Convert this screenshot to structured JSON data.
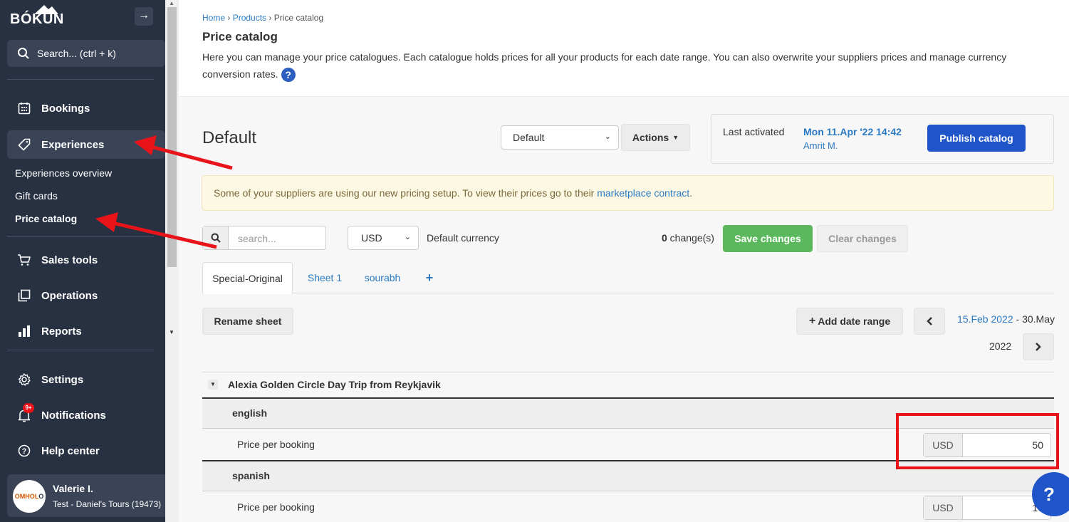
{
  "sidebar": {
    "logo": "BÓKUN",
    "search_label": "Search... (ctrl + k)",
    "nav": {
      "bookings": "Bookings",
      "experiences": "Experiences",
      "sales_tools": "Sales tools",
      "operations": "Operations",
      "reports": "Reports",
      "settings": "Settings",
      "notifications": "Notifications",
      "notifications_badge": "9+",
      "help_center": "Help center"
    },
    "sub_items": {
      "overview": "Experiences overview",
      "gift_cards": "Gift cards",
      "price_catalog": "Price catalog"
    },
    "user": {
      "avatar_text_a": "OMHOL",
      "avatar_text_b": "O",
      "name": "Valerie I.",
      "account": "Test - Daniel's Tours (19473)"
    }
  },
  "header": {
    "breadcrumb": [
      "Home",
      "Products",
      "Price catalog"
    ],
    "title": "Price catalog",
    "description": "Here you can manage your price catalogues. Each catalogue holds prices for all your products for each date range. You can also overwrite your suppliers prices and manage currency conversion rates."
  },
  "catalog": {
    "heading": "Default",
    "selected_catalog": "Default",
    "actions_label": "Actions",
    "last_activated_label": "Last activated",
    "last_activated_date": "Mon 11.Apr '22 14:42",
    "last_activated_by": "Amrit M.",
    "publish_label": "Publish catalog"
  },
  "alert": {
    "text": "Some of your suppliers are using our new pricing setup. To view their prices go to their ",
    "link": "marketplace contract",
    "end": "."
  },
  "toolbar": {
    "search_placeholder": "search...",
    "currency": "USD",
    "currency_label": "Default currency",
    "changes_count": "0",
    "changes_suffix": " change(s)",
    "save_label": "Save changes",
    "clear_label": "Clear changes"
  },
  "tabs": [
    "Special-Original",
    "Sheet 1",
    "sourabh"
  ],
  "sheet": {
    "rename_label": "Rename sheet",
    "add_date_range_label": "Add date range",
    "date_from": "15.Feb 2022",
    "date_sep": " - ",
    "date_to": "30.May",
    "date_year": "2022"
  },
  "product": {
    "name": "Alexia Golden Circle Day Trip from Reykjavik",
    "languages": [
      {
        "name": "english",
        "price_label": "Price per booking",
        "currency": "USD",
        "value": "50"
      },
      {
        "name": "spanish",
        "price_label": "Price per booking",
        "currency": "USD",
        "value": "10"
      }
    ]
  },
  "colors": {
    "sidebar_bg": "#273142",
    "accent_blue": "#1f55c8",
    "link_blue": "#2c7ac2",
    "save_green": "#5cb85c",
    "annotation_red": "#e8141a"
  }
}
